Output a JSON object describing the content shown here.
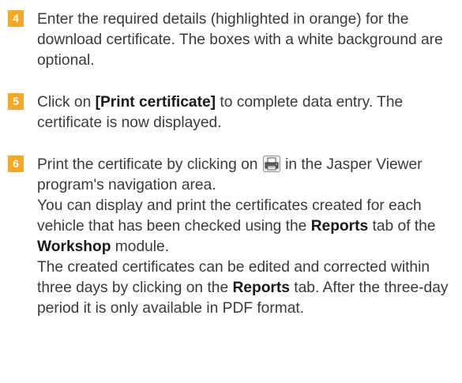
{
  "colors": {
    "badge": "#f5a623",
    "text": "#3a3a3a"
  },
  "steps": [
    {
      "number": "4",
      "text": "Enter the required details (highlighted in orange) for the download certificate. The boxes with a white background are optional."
    },
    {
      "number": "5",
      "prefix": "Click on ",
      "bold": "[Print certificate]",
      "suffix": " to complete data entry. The certificate is now displayed."
    },
    {
      "number": "6",
      "line1_before_icon": "Print the certificate by clicking on ",
      "icon": "printer-icon",
      "line1_after_icon": " in the Jasper Viewer program's navigation area.",
      "para2_a": "You can display and print the certificates created for each vehicle that has been checked using the ",
      "para2_bold1": "Reports",
      "para2_b": " tab of the ",
      "para2_bold2": "Workshop",
      "para2_c": " module.",
      "para3_a": "The created certificates can be edited and corrected within three days by clicking on the ",
      "para3_bold": "Reports",
      "para3_b": " tab. After the three-day period it is only available in PDF format."
    }
  ]
}
